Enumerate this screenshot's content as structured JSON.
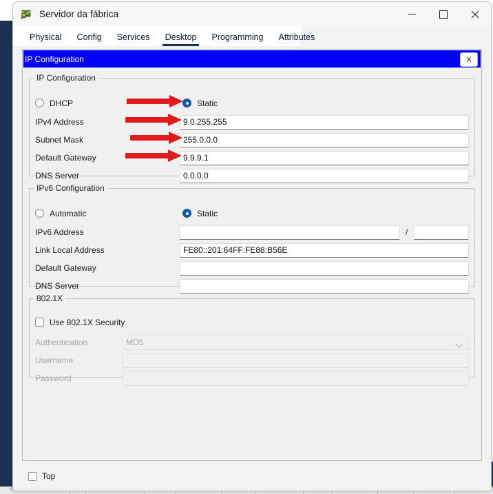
{
  "window": {
    "title": "Servidor da fábrica",
    "icon": "packet-tracer-icon",
    "minimize_label": "",
    "maximize_label": "",
    "close_label": "✕"
  },
  "tabs": [
    {
      "label": "Physical",
      "active": false
    },
    {
      "label": "Config",
      "active": false
    },
    {
      "label": "Services",
      "active": false
    },
    {
      "label": "Desktop",
      "active": true
    },
    {
      "label": "Programming",
      "active": false
    },
    {
      "label": "Attributes",
      "active": false
    }
  ],
  "dialog": {
    "title": "IP Configuration",
    "close_label": "X",
    "close_color": "#0000ff"
  },
  "ipv4": {
    "legend": "IP Configuration",
    "dhcp_label": "DHCP",
    "static_label": "Static",
    "mode": "Static",
    "fields": [
      {
        "label": "IPv4 Address",
        "value": "9.0.255.255",
        "annotated": true
      },
      {
        "label": "Subnet Mask",
        "value": "255.0.0.0",
        "annotated": true
      },
      {
        "label": "Default Gateway",
        "value": "9.9.9.1",
        "annotated": true
      },
      {
        "label": "DNS Server",
        "value": "0.0.0.0",
        "annotated": false
      }
    ]
  },
  "ipv6": {
    "legend": "IPv6 Configuration",
    "automatic_label": "Automatic",
    "static_label": "Static",
    "mode": "Static",
    "prefix_separator": "/",
    "fields": [
      {
        "label": "IPv6 Address",
        "value": ""
      },
      {
        "label": "Link Local Address",
        "value": "FE80::201:64FF:FE88:B56E"
      },
      {
        "label": "Default Gateway",
        "value": ""
      },
      {
        "label": "DNS Server",
        "value": ""
      }
    ],
    "prefix_value": ""
  },
  "dot1x": {
    "legend": "802.1X",
    "use_security_label": "Use 802.1X Security",
    "use_security_checked": false,
    "fields": [
      {
        "label": "Authentication",
        "value": "MD5",
        "type": "dropdown",
        "disabled": true
      },
      {
        "label": "Username",
        "value": "",
        "type": "text",
        "disabled": true
      },
      {
        "label": "Password",
        "value": "",
        "type": "text",
        "disabled": true
      }
    ]
  },
  "footer": {
    "top_label": "Top",
    "top_checked": false
  },
  "annotation": {
    "color": "#e11b1b",
    "arrow_count": 4
  }
}
